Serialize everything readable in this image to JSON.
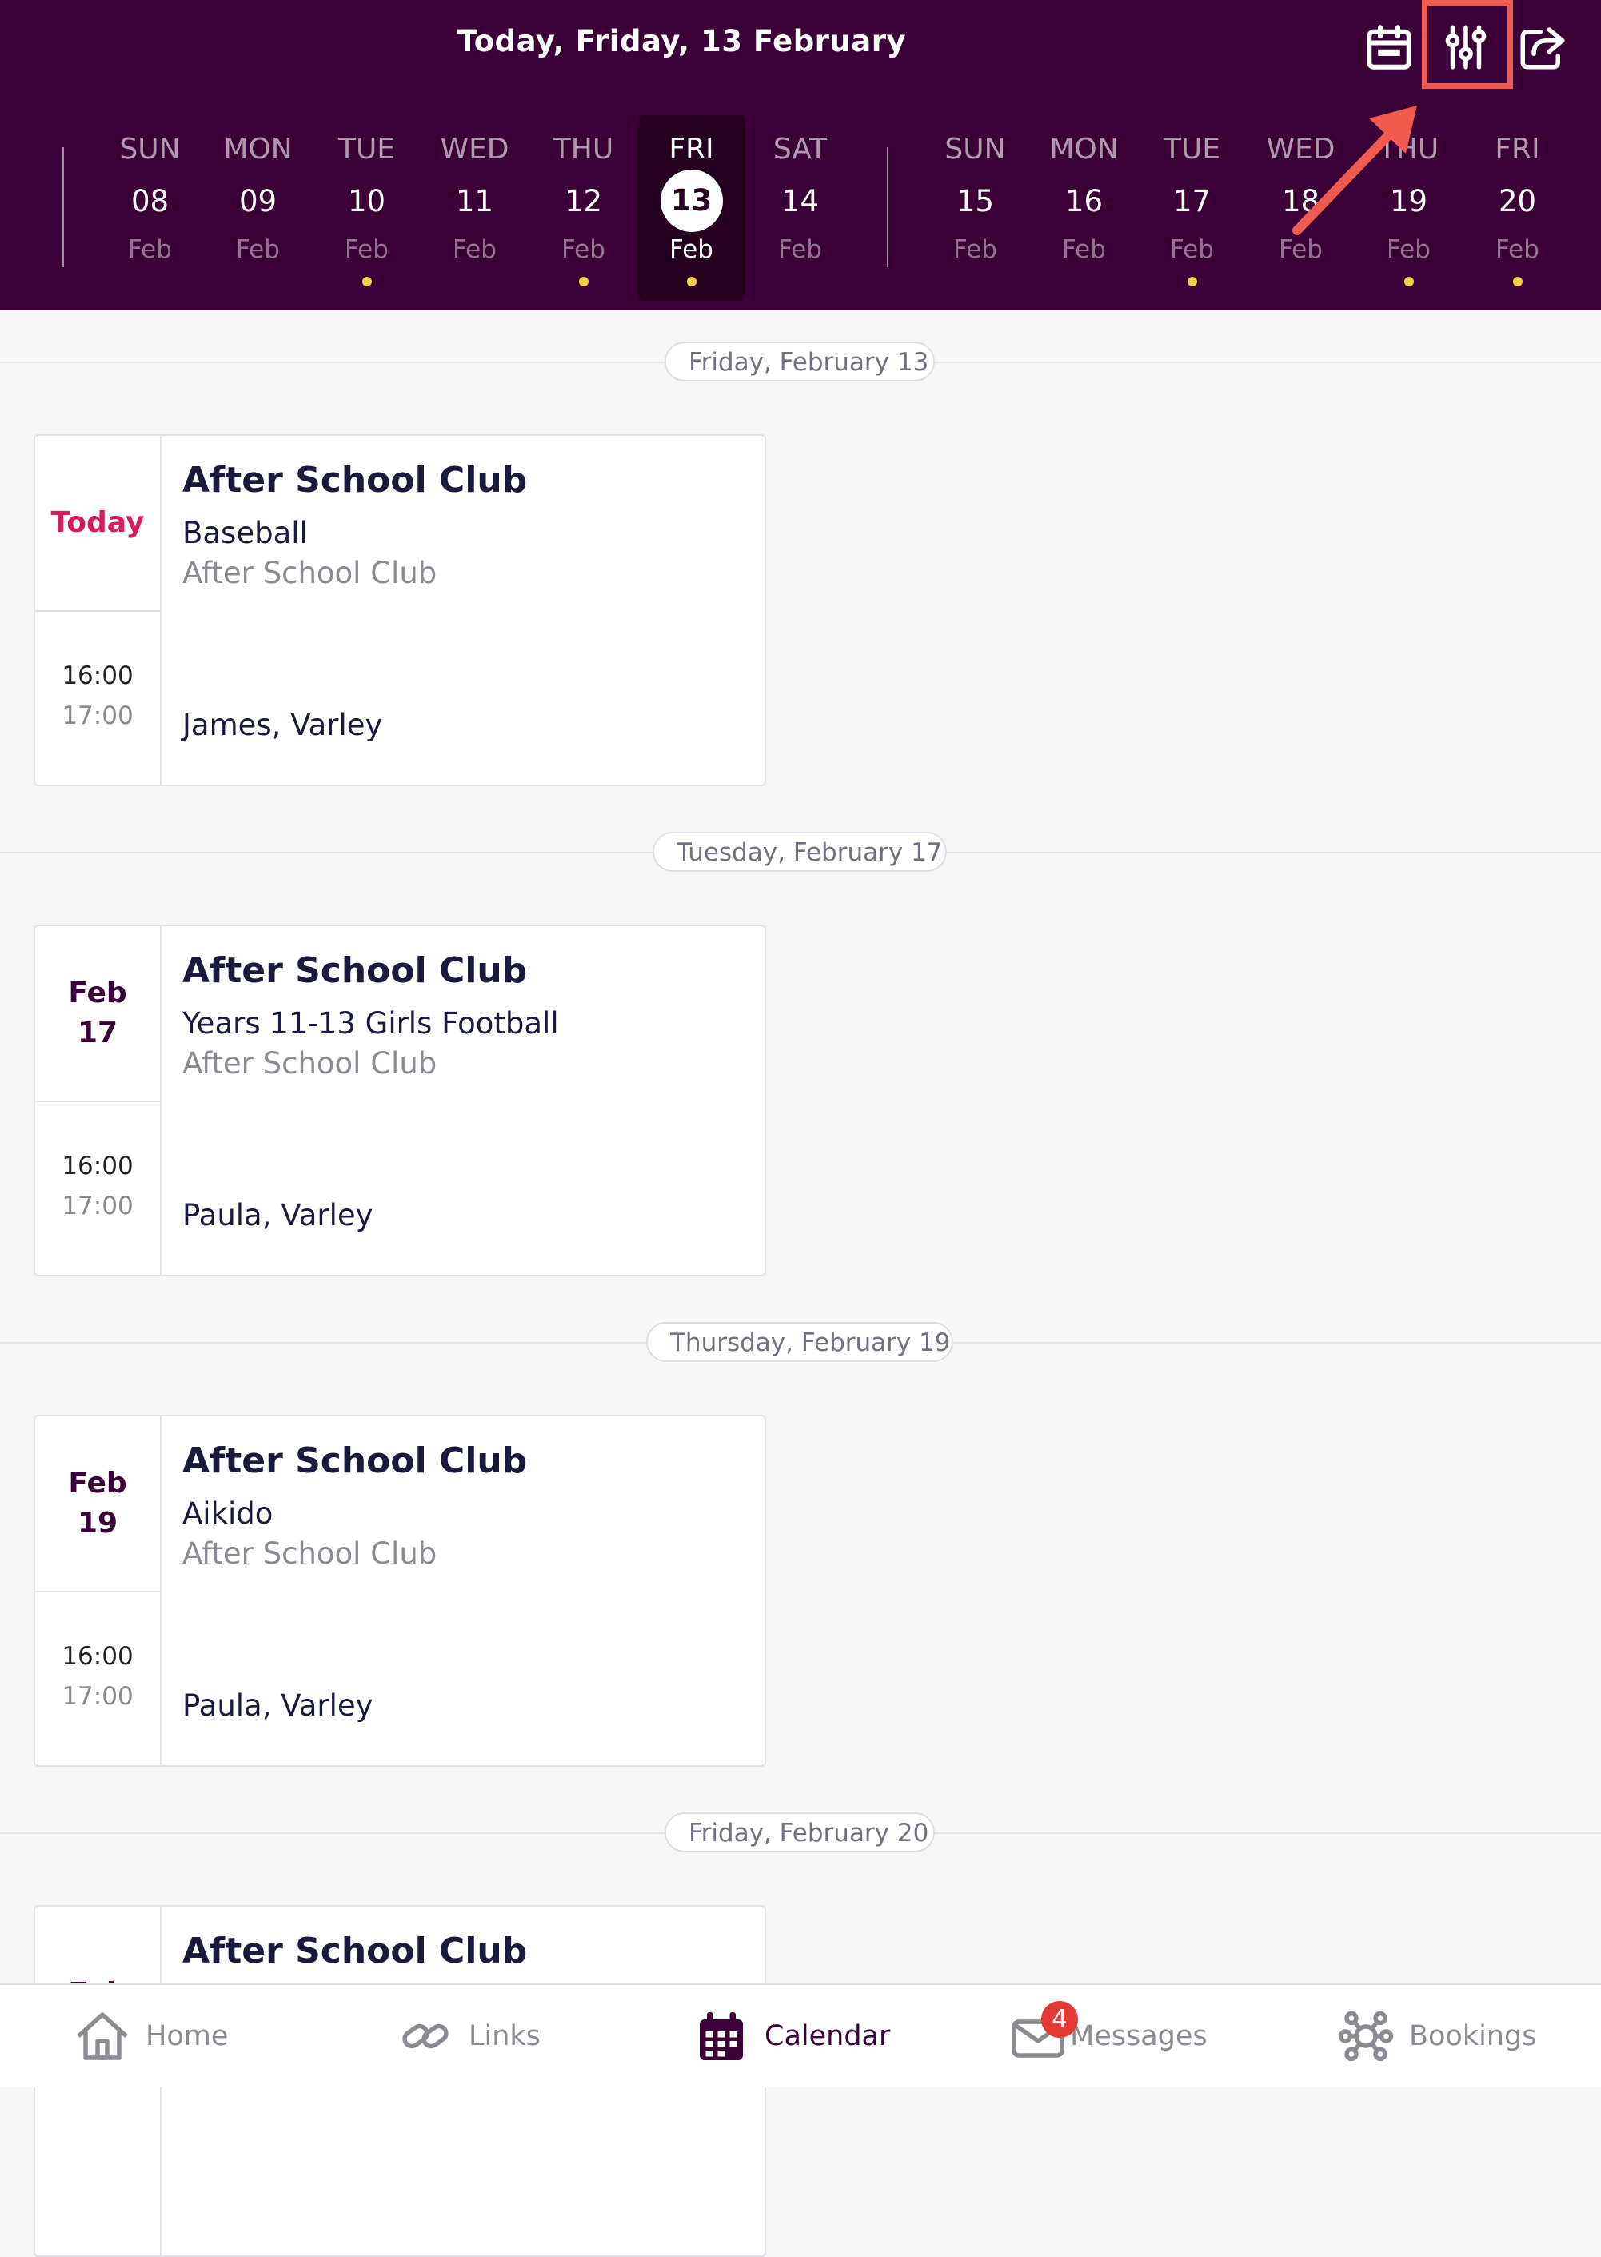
{
  "header": {
    "title": "Today, Friday, 13 February",
    "icons": [
      "calendar-icon",
      "filter-sliders-icon",
      "share-icon"
    ]
  },
  "week_strip": [
    {
      "dow": "SUN",
      "day": "08",
      "month": "Feb",
      "dot": false,
      "selected": false
    },
    {
      "dow": "MON",
      "day": "09",
      "month": "Feb",
      "dot": false,
      "selected": false
    },
    {
      "dow": "TUE",
      "day": "10",
      "month": "Feb",
      "dot": true,
      "selected": false
    },
    {
      "dow": "WED",
      "day": "11",
      "month": "Feb",
      "dot": false,
      "selected": false
    },
    {
      "dow": "THU",
      "day": "12",
      "month": "Feb",
      "dot": true,
      "selected": false
    },
    {
      "dow": "FRI",
      "day": "13",
      "month": "Feb",
      "dot": true,
      "selected": true
    },
    {
      "dow": "SAT",
      "day": "14",
      "month": "Feb",
      "dot": false,
      "selected": false
    },
    {
      "dow": "SUN",
      "day": "15",
      "month": "Feb",
      "dot": false,
      "selected": false
    },
    {
      "dow": "MON",
      "day": "16",
      "month": "Feb",
      "dot": false,
      "selected": false
    },
    {
      "dow": "TUE",
      "day": "17",
      "month": "Feb",
      "dot": true,
      "selected": false
    },
    {
      "dow": "WED",
      "day": "18",
      "month": "Feb",
      "dot": false,
      "selected": false
    },
    {
      "dow": "THU",
      "day": "19",
      "month": "Feb",
      "dot": true,
      "selected": false
    },
    {
      "dow": "FRI",
      "day": "20",
      "month": "Feb",
      "dot": true,
      "selected": false
    }
  ],
  "sections": [
    {
      "date_label": "Friday, February 13",
      "event": {
        "date": "Today",
        "is_today": true,
        "title": "After School Club",
        "activity": "Baseball",
        "category": "After School Club",
        "start": "16:00",
        "end": "17:00",
        "staff": "James, Varley"
      }
    },
    {
      "date_label": "Tuesday, February 17",
      "event": {
        "date": "Feb\n17",
        "is_today": false,
        "title": "After School Club",
        "activity": "Years 11-13 Girls Football",
        "category": "After School Club",
        "start": "16:00",
        "end": "17:00",
        "staff": "Paula, Varley"
      }
    },
    {
      "date_label": "Thursday, February 19",
      "event": {
        "date": "Feb\n19",
        "is_today": false,
        "title": "After School Club",
        "activity": "Aikido",
        "category": "After School Club",
        "start": "16:00",
        "end": "17:00",
        "staff": "Paula, Varley"
      }
    },
    {
      "date_label": "Friday, February 20",
      "event": {
        "date": "Feb",
        "is_today": false,
        "title": "After School Club",
        "activity": "",
        "category": "",
        "start": "",
        "end": "",
        "staff": ""
      }
    }
  ],
  "tabbar": [
    {
      "label": "Home",
      "icon": "home-icon",
      "active": false
    },
    {
      "label": "Links",
      "icon": "link-icon",
      "active": false
    },
    {
      "label": "Calendar",
      "icon": "calendar-icon",
      "active": true
    },
    {
      "label": "Messages",
      "icon": "envelope-icon",
      "active": false,
      "badge": "4"
    },
    {
      "label": "Bookings",
      "icon": "network-icon",
      "active": false
    }
  ],
  "colors": {
    "header_bg": "#3b0037",
    "selected_day_bg": "#26001f",
    "event_dot": "#f7d14a",
    "today_text": "#d81b60",
    "annotation": "#f05a4f",
    "badge": "#e53935"
  }
}
